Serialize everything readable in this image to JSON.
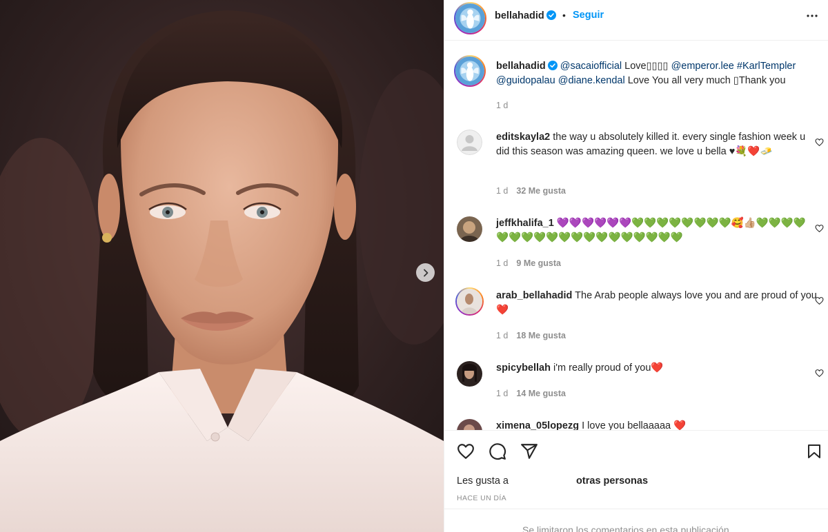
{
  "photo": {
    "alt_icon": "model-portrait"
  },
  "carousel": {
    "next_icon": "chevron-right-icon"
  },
  "header": {
    "username": "bellahadid",
    "dot": "•",
    "follow_label": "Seguir",
    "more_icon": "more-horizontal-icon"
  },
  "caption": {
    "username": "bellahadid",
    "mention1": "@sacaiofficial",
    "text1": " Love▯▯▯▯ ",
    "mention2": "@emperor.lee",
    "hashtag": "#KarlTempler",
    "mention3": "@guidopalau",
    "mention4": "@diane.kendal",
    "text2": " Love You all very much ▯Thank you",
    "time": "1 d"
  },
  "comments": [
    {
      "username": "editskayla2",
      "text": " the way u absolutely killed it. every single fashion week u did this season was amazing queen. we love u bella ♥💐❤️🧈",
      "time": "1 d",
      "likes": "32 Me gusta"
    },
    {
      "username": "jeffkhalifa_1",
      "text": " 💜💜💜💜💜💜💚💚💚💚💚💚💚💚🥰👍🏼💚💚💚💚💚💚💚💚💚💚💚💚💚💚💚💚💚💚💚",
      "time": "1 d",
      "likes": "9 Me gusta"
    },
    {
      "username": "arab_bellahadid",
      "text": " The Arab people always love you and are proud of you❤️",
      "time": "1 d",
      "likes": "18 Me gusta"
    },
    {
      "username": "spicybellah",
      "text": " i'm really proud of you❤️",
      "time": "1 d",
      "likes": "14 Me gusta"
    },
    {
      "username": "ximena_05lopezg",
      "text": " I love you bellaaaaa ❤️"
    }
  ],
  "actions": {
    "like_icon": "heart-icon",
    "comment_icon": "comment-icon",
    "share_icon": "send-icon",
    "save_icon": "bookmark-icon",
    "likes_prefix": "Les gusta a",
    "likes_suffix": "otras personas",
    "time_ago": "HACE UN DÍA",
    "limited_notice": "Se limitaron los comentarios en esta publicación."
  },
  "colors": {
    "link_blue": "#0095f6",
    "mention": "#00376b",
    "muted": "#8e8e8e",
    "heart_red": "#c0141d"
  }
}
